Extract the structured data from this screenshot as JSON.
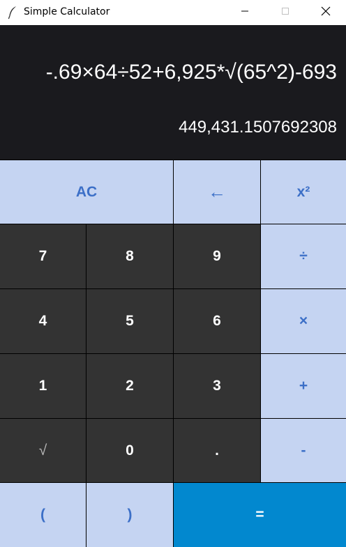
{
  "window": {
    "title": "Simple Calculator",
    "icon": "feather-icon",
    "controls": [
      "minimize-icon",
      "maximize-icon",
      "close-icon"
    ]
  },
  "display": {
    "expression": "-.69×64÷52+6,925*√(65^2)-693",
    "result": "449,431.1507692308"
  },
  "keys": {
    "ac": "AC",
    "backspace": "←",
    "square": "x²",
    "seven": "7",
    "eight": "8",
    "nine": "9",
    "divide": "÷",
    "four": "4",
    "five": "5",
    "six": "6",
    "multiply": "×",
    "one": "1",
    "two": "2",
    "three": "3",
    "plus": "+",
    "sqrt": "√",
    "zero": "0",
    "dot": ".",
    "minus": "-",
    "lparen": "(",
    "rparen": ")",
    "equals": "="
  },
  "colors": {
    "display_bg": "#1a1a1e",
    "light_key": "#c5d4f2",
    "light_key_text": "#3c6fc7",
    "dark_key": "#333333",
    "equals_key": "#0288cf"
  }
}
